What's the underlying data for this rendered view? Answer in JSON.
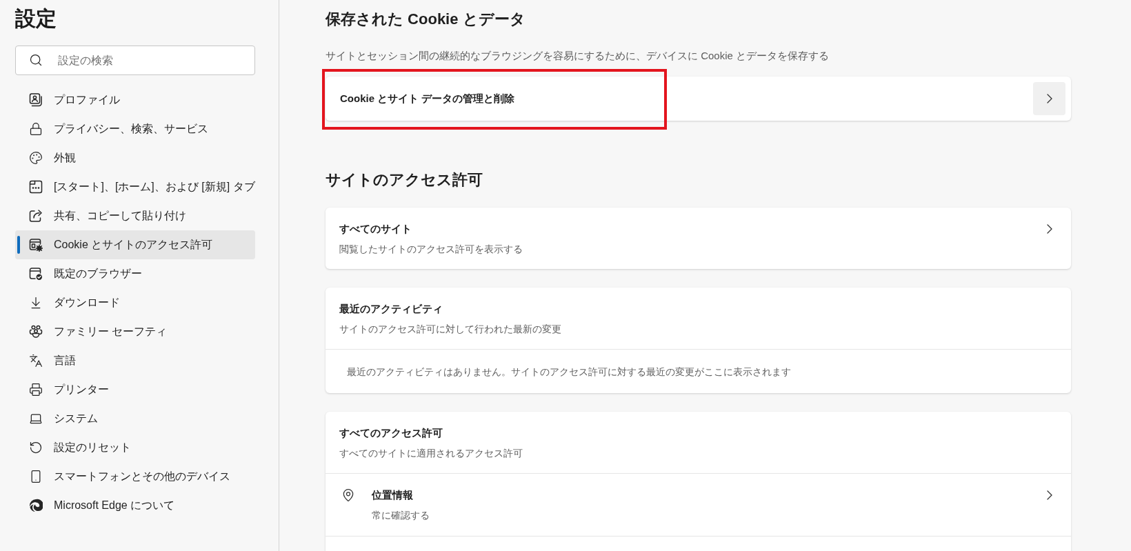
{
  "sidebar": {
    "title": "設定",
    "search": {
      "placeholder": "設定の検索"
    },
    "items": [
      {
        "label": "プロファイル",
        "selected": false
      },
      {
        "label": "プライバシー、検索、サービス",
        "selected": false
      },
      {
        "label": "外観",
        "selected": false
      },
      {
        "label": "[スタート]、[ホーム]、および [新規] タブ",
        "selected": false
      },
      {
        "label": "共有、コピーして貼り付け",
        "selected": false
      },
      {
        "label": "Cookie とサイトのアクセス許可",
        "selected": true
      },
      {
        "label": "既定のブラウザー",
        "selected": false
      },
      {
        "label": "ダウンロード",
        "selected": false
      },
      {
        "label": "ファミリー セーフティ",
        "selected": false
      },
      {
        "label": "言語",
        "selected": false
      },
      {
        "label": "プリンター",
        "selected": false
      },
      {
        "label": "システム",
        "selected": false
      },
      {
        "label": "設定のリセット",
        "selected": false
      },
      {
        "label": "スマートフォンとその他のデバイス",
        "selected": false
      },
      {
        "label": "Microsoft Edge について",
        "selected": false
      }
    ]
  },
  "main": {
    "sections": [
      {
        "heading": "保存された Cookie とデータ",
        "description": "サイトとセッション間の継続的なブラウジングを容易にするために、デバイスに Cookie とデータを保存する",
        "cards": [
          {
            "kind": "button_row",
            "title": "Cookie とサイト データの管理と削除",
            "highlighted": true
          }
        ]
      },
      {
        "heading": "サイトのアクセス許可",
        "cards": [
          {
            "kind": "link",
            "title": "すべてのサイト",
            "subtitle": "閲覧したサイトのアクセス許可を表示する"
          },
          {
            "kind": "activity",
            "title": "最近のアクティビティ",
            "subtitle": "サイトのアクセス許可に対して行われた最新の変更",
            "message": "最近のアクティビティはありません。サイトのアクセス許可に対する最近の変更がここに表示されます"
          },
          {
            "kind": "group",
            "title": "すべてのアクセス許可",
            "subtitle": "すべてのサイトに適用されるアクセス許可",
            "items": [
              {
                "title": "位置情報",
                "subtitle": "常に確認する"
              }
            ]
          }
        ]
      }
    ]
  }
}
